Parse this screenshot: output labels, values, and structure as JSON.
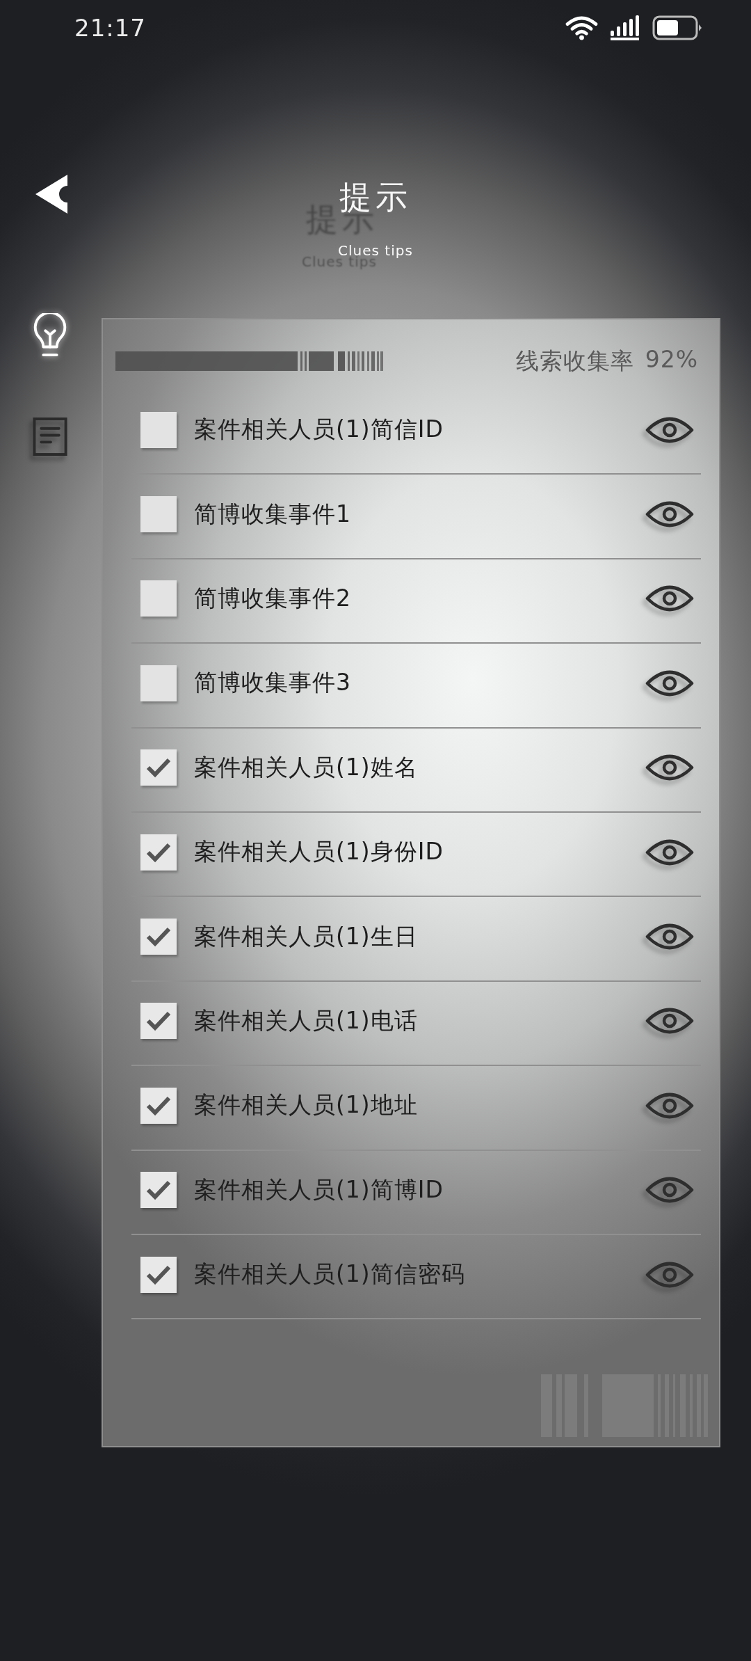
{
  "status_bar": {
    "time": "21:17"
  },
  "header": {
    "title": "提示",
    "subtitle": "Clues tips"
  },
  "sidebar": {
    "items": [
      {
        "kind": "bulb",
        "selected": true
      },
      {
        "kind": "document",
        "selected": false
      }
    ]
  },
  "panel": {
    "collection_rate": {
      "label": "线索收集率",
      "value": "92%"
    },
    "clues": [
      {
        "label": "案件相关人员(1)简信ID",
        "checked": false
      },
      {
        "label": "简博收集事件1",
        "checked": false
      },
      {
        "label": "简博收集事件2",
        "checked": false
      },
      {
        "label": "简博收集事件3",
        "checked": false
      },
      {
        "label": "案件相关人员(1)姓名",
        "checked": true
      },
      {
        "label": "案件相关人员(1)身份ID",
        "checked": true
      },
      {
        "label": "案件相关人员(1)生日",
        "checked": true
      },
      {
        "label": "案件相关人员(1)电话",
        "checked": true
      },
      {
        "label": "案件相关人员(1)地址",
        "checked": true
      },
      {
        "label": "案件相关人员(1)简博ID",
        "checked": true
      },
      {
        "label": "案件相关人员(1)简信密码",
        "checked": true
      }
    ]
  }
}
